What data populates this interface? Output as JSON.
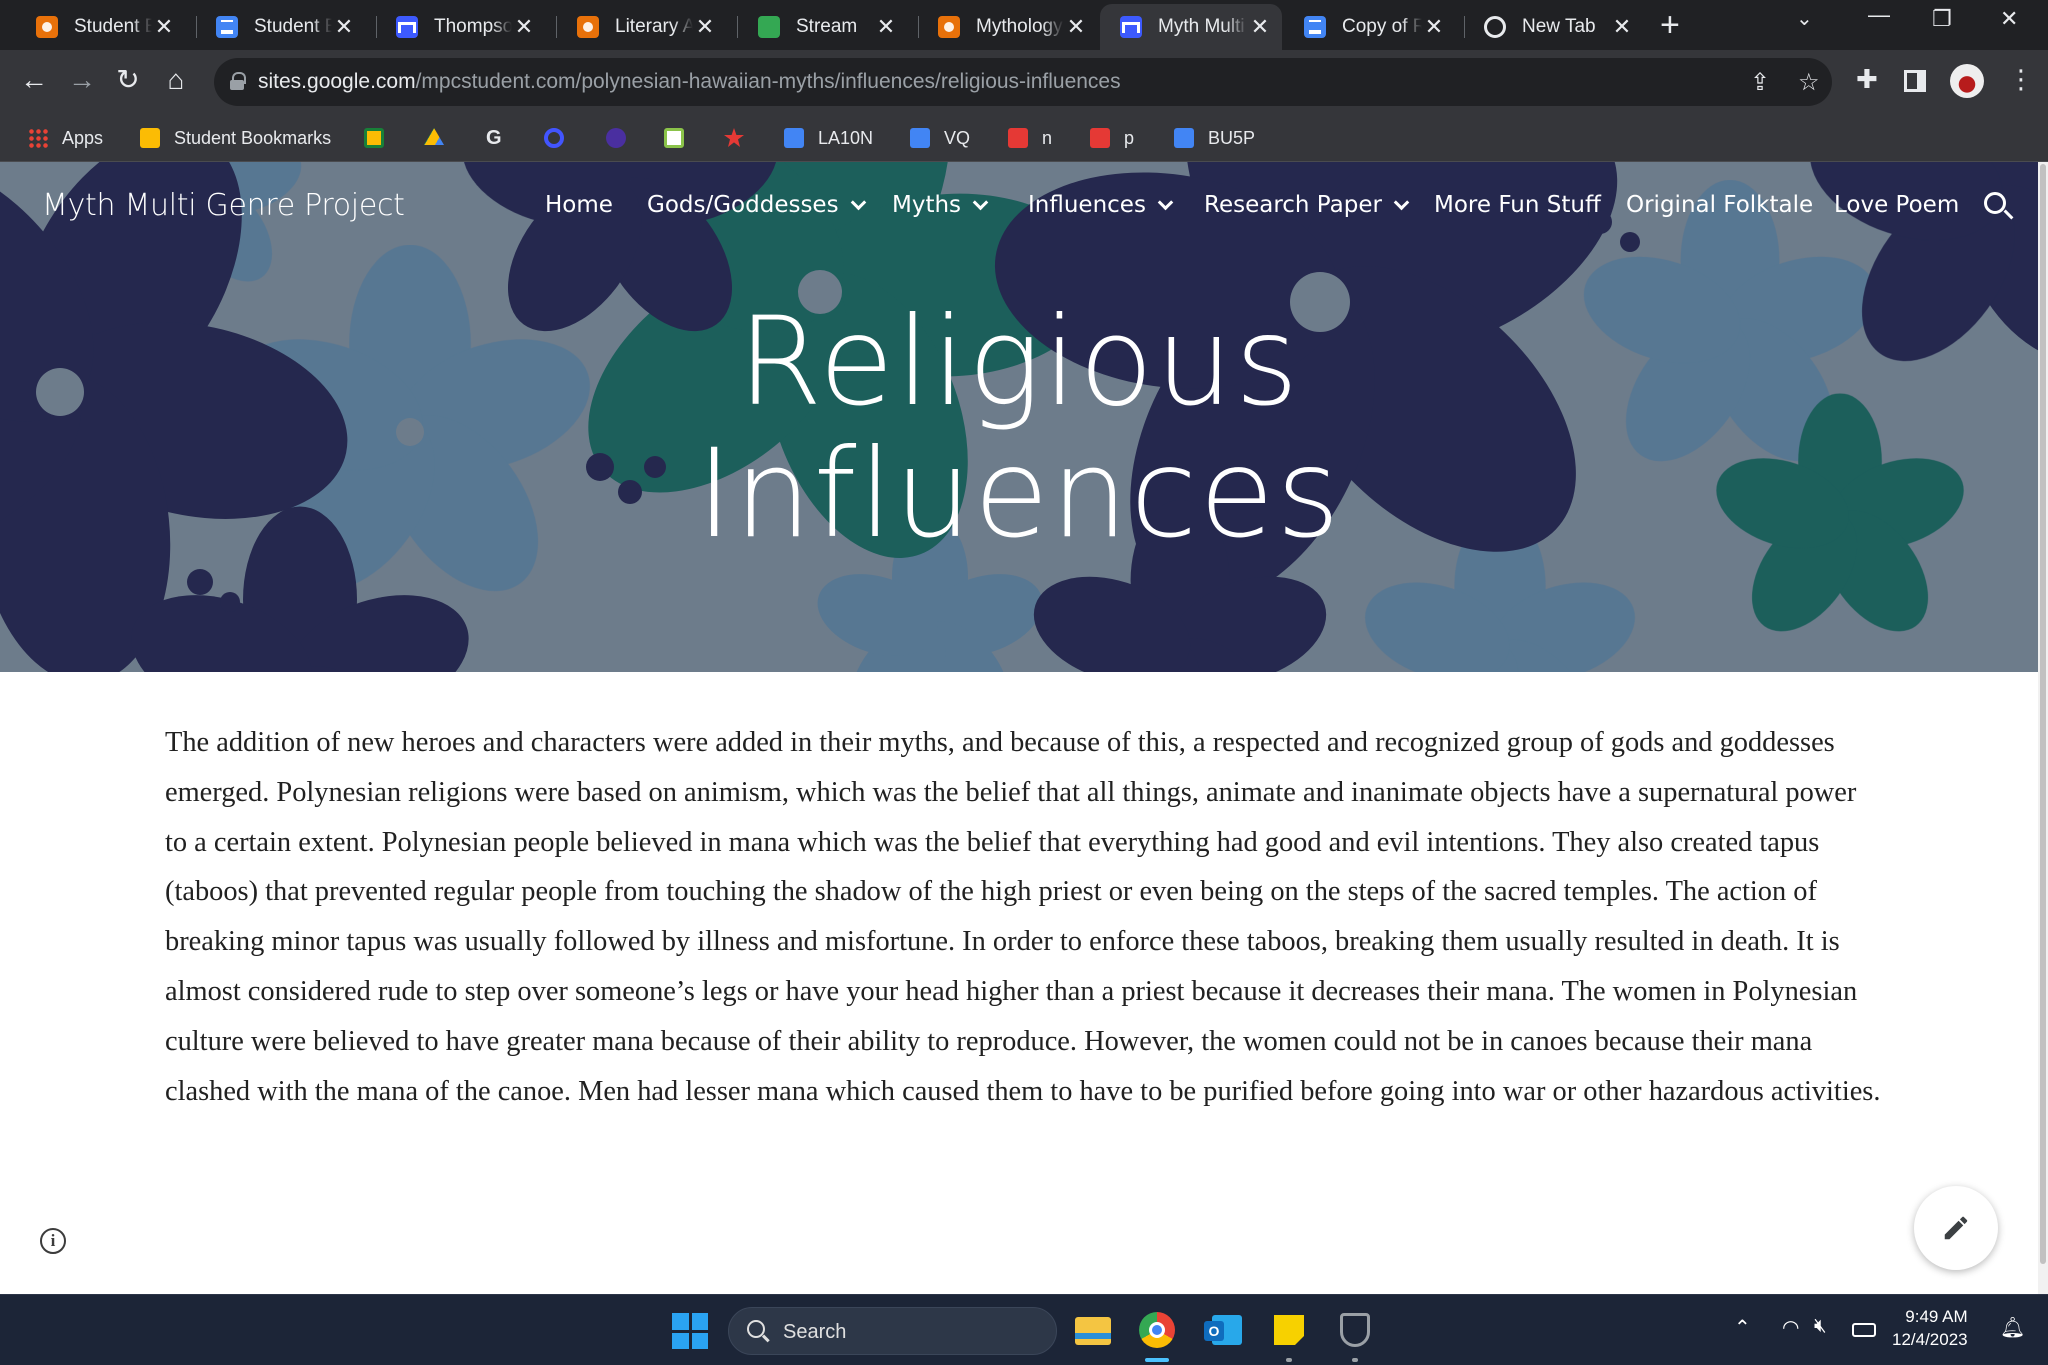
{
  "browser": {
    "tabs": [
      {
        "title": "Student Engagement",
        "icon": "classroom-assignment-icon",
        "color": "#e8710a",
        "active": false
      },
      {
        "title": "Student Essay",
        "icon": "google-docs-icon",
        "color": "#4285f4",
        "active": false
      },
      {
        "title": "Thompson",
        "icon": "google-sites-icon",
        "color": "#3d5afe",
        "active": false
      },
      {
        "title": "Literary Analysis",
        "icon": "classroom-assignment-icon",
        "color": "#e8710a",
        "active": false
      },
      {
        "title": "Stream",
        "icon": "google-classroom-icon",
        "color": "#34a853",
        "active": false
      },
      {
        "title": "Mythology",
        "icon": "classroom-assignment-icon",
        "color": "#e8710a",
        "active": false
      },
      {
        "title": "Myth Multi Genre Project",
        "icon": "google-sites-icon",
        "color": "#3d5afe",
        "active": true
      },
      {
        "title": "Copy of Research",
        "icon": "google-docs-icon",
        "color": "#4285f4",
        "active": false
      },
      {
        "title": "New Tab",
        "icon": "chrome-icon",
        "color": "#e8eaed",
        "active": false
      }
    ],
    "url_host": "sites.google.com",
    "url_path": "/mpcstudent.com/polynesian-hawaiian-myths/influences/religious-influences",
    "bookmarks": [
      {
        "label": "Apps",
        "icon": "apps-grid-icon",
        "color": "#e94235"
      },
      {
        "label": "Student Bookmarks",
        "icon": "folder-icon",
        "color": "#fbbc04"
      },
      {
        "label": "",
        "icon": "google-classroom-icon",
        "color": "#fbbc04"
      },
      {
        "label": "",
        "icon": "google-drive-icon",
        "color": "#34a853"
      },
      {
        "label": "",
        "icon": "google-icon",
        "color": "#ffffff"
      },
      {
        "label": "",
        "icon": "quizlet-icon",
        "color": "#4255ff"
      },
      {
        "label": "",
        "icon": "quill-icon",
        "color": "#6a4fd6"
      },
      {
        "label": "",
        "icon": "ixl-icon",
        "color": "#8bc34a"
      },
      {
        "label": "",
        "icon": "puzzle-red-icon",
        "color": "#e53935"
      },
      {
        "label": "LA10N",
        "icon": "google-docs-icon",
        "color": "#4285f4"
      },
      {
        "label": "VQ",
        "icon": "google-docs-icon",
        "color": "#4285f4"
      },
      {
        "label": "n",
        "icon": "bookmark-red-icon",
        "color": "#e53935"
      },
      {
        "label": "p",
        "icon": "bookmark-red-icon",
        "color": "#e53935"
      },
      {
        "label": "BU5P",
        "icon": "google-docs-icon",
        "color": "#4285f4"
      }
    ]
  },
  "site": {
    "title": "Myth Multi Genre Project",
    "nav": [
      {
        "label": "Home",
        "dropdown": false
      },
      {
        "label": "Gods/Goddesses",
        "dropdown": true
      },
      {
        "label": "Myths",
        "dropdown": true
      },
      {
        "label": "Influences",
        "dropdown": true
      },
      {
        "label": "Research Paper",
        "dropdown": true
      },
      {
        "label": "More Fun Stuff",
        "dropdown": false
      },
      {
        "label": "Original Folktale",
        "dropdown": false
      },
      {
        "label": "Love Poem",
        "dropdown": false
      }
    ],
    "hero_title_line1": "Religious",
    "hero_title_line2": "Influences",
    "body": "The addition of new heroes and characters were added in their myths, and because of this, a respected and recognized group of gods and goddesses emerged. Polynesian religions were based on animism, which was the belief that all things, animate and inanimate objects have a supernatural power to a certain extent. Polynesian people believed in mana which was the belief that everything had good and evil intentions. They also created tapus (taboos) that prevented regular people from touching the shadow of the high priest or even being on the steps of the sacred temples. The action of breaking minor tapus was usually followed by illness and misfortune. In order to enforce these taboos, breaking them usually resulted in death. It is almost considered rude to step over someone’s legs or have your head higher than a priest because it decreases their mana. The women in Polynesian culture were believed to have greater mana because of their ability to reproduce. However, the women could not be in canoes because their mana clashed with the mana of the canoe. Men had lesser mana which caused them to have to be purified before going into war or other hazardous activities."
  },
  "taskbar": {
    "search_label": "Search",
    "time": "9:49 AM",
    "date": "12/4/2023"
  },
  "colors": {
    "hero_navy": "#2b2f5e",
    "hero_teal": "#1f7a70",
    "hero_blue": "#5f8fb2",
    "hero_background": "#8a9cac"
  }
}
